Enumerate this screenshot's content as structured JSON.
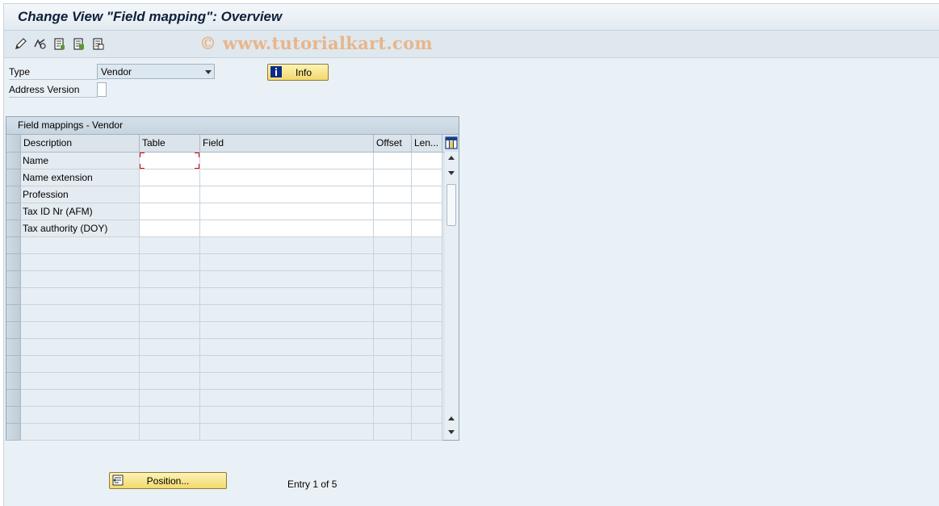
{
  "window": {
    "title": "Change View \"Field mapping\": Overview",
    "watermark": "© www.tutorialkart.com"
  },
  "toolbar": {
    "buttons": [
      "edit-pencil-icon",
      "undo-icon",
      "copy-entries-icon",
      "select-all-icon",
      "deselect-all-icon"
    ]
  },
  "form": {
    "type_label": "Type",
    "type_value": "Vendor",
    "address_version_label": "Address Version",
    "address_version_value": "",
    "info_button": "Info"
  },
  "table": {
    "caption": "Field mappings - Vendor",
    "columns": [
      "Description",
      "Table",
      "Field",
      "Offset",
      "Len..."
    ],
    "rows": [
      {
        "description": "Name",
        "table": "",
        "field": "",
        "offset": "",
        "length": ""
      },
      {
        "description": "Name extension",
        "table": "",
        "field": "",
        "offset": "",
        "length": ""
      },
      {
        "description": "Profession",
        "table": "",
        "field": "",
        "offset": "",
        "length": ""
      },
      {
        "description": "Tax ID Nr (AFM)",
        "table": "",
        "field": "",
        "offset": "",
        "length": ""
      },
      {
        "description": "Tax authority (DOY)",
        "table": "",
        "field": "",
        "offset": "",
        "length": ""
      }
    ],
    "empty_rows": 12
  },
  "footer": {
    "position_button": "Position...",
    "entry_text": "Entry 1 of 5"
  },
  "colors": {
    "accent_button": "#f2d96b",
    "background": "#eaf1f6"
  }
}
